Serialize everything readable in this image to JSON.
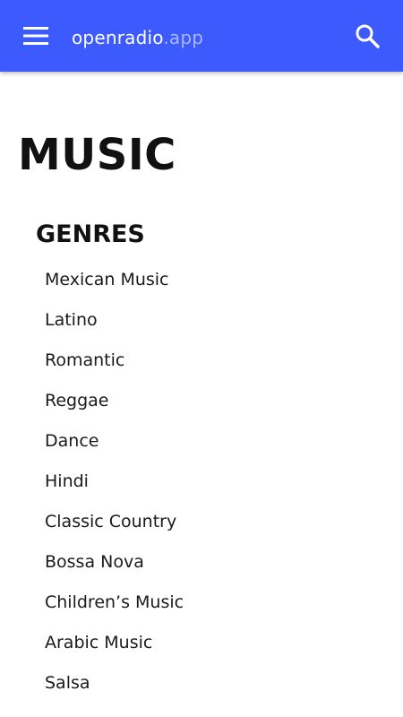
{
  "appbar": {
    "brand_name": "openradio",
    "brand_tld": ".app",
    "menu_icon": "menu-icon",
    "search_icon": "search-icon",
    "background": "#3d5afe"
  },
  "page": {
    "title": "MUSIC",
    "section_title": "GENRES"
  },
  "genres": [
    "Mexican Music",
    "Latino",
    "Romantic",
    "Reggae",
    "Dance",
    "Hindi",
    "Classic Country",
    "Bossa Nova",
    "Children’s Music",
    "Arabic Music",
    "Salsa"
  ]
}
